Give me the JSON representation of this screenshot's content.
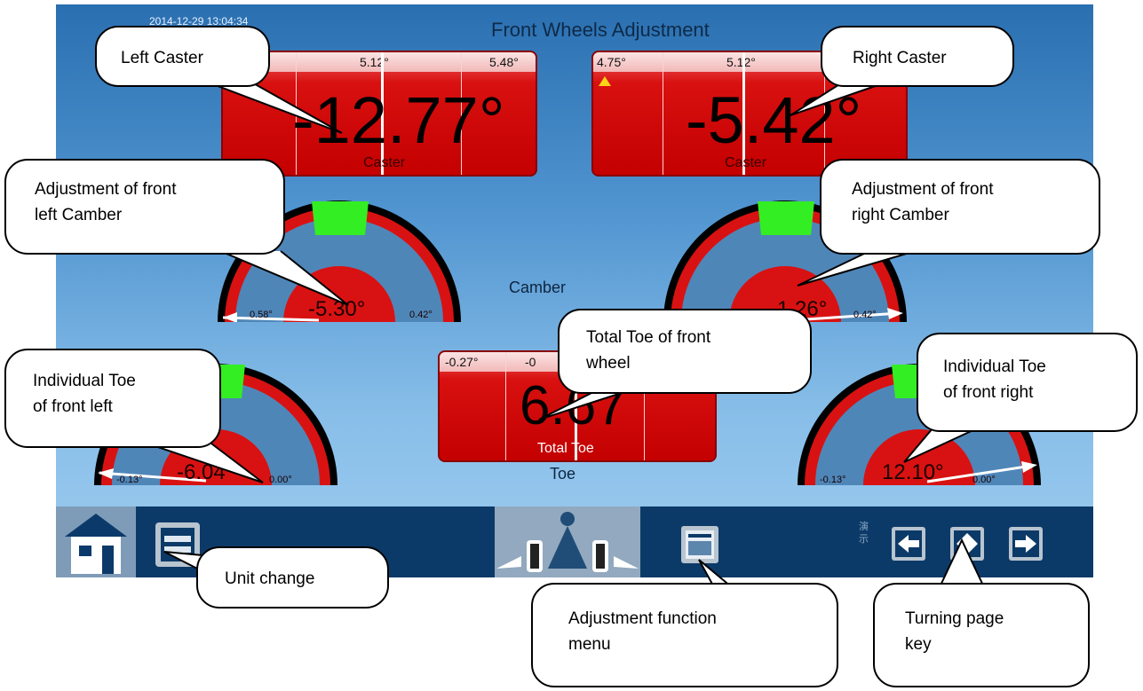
{
  "screen": {
    "timestamp": "2014-12-29 13:04:34",
    "title": "Front Wheels Adjustment"
  },
  "left_caster": {
    "ticks": [
      "5.12°",
      "5.48°"
    ],
    "value": "-12.77°",
    "label": "Caster"
  },
  "right_caster": {
    "ticks": [
      "4.75°",
      "5.12°"
    ],
    "value": "-5.42°",
    "label": "Caster"
  },
  "left_camber": {
    "value": "-5.30°",
    "min": "0.58°",
    "max": "0.42°"
  },
  "right_camber": {
    "value": "-1.26°",
    "max": "0.42°"
  },
  "camber_label": "Camber",
  "total_toe": {
    "ticks": [
      "-0.27°",
      "-0"
    ],
    "value": "6.67",
    "label": "Total Toe"
  },
  "toe_label": "Toe",
  "left_toe": {
    "value": "-6.04°",
    "min": "-0.13°",
    "max": "0.00°"
  },
  "right_toe": {
    "value": "12.10°",
    "min": "-0.13°",
    "max": "0.00°"
  },
  "footer": {
    "demo_label": "演示"
  },
  "callouts": {
    "left_caster": "Left Caster",
    "right_caster": "Right Caster",
    "front_left_camber": "Adjustment  of  front\nleft Camber",
    "front_right_camber": "Adjustment  of  front\nright Camber",
    "total_toe": "Total  Toe  of  front\nwheel",
    "individual_toe_left": "Individual   Toe\nof front left",
    "individual_toe_right": "Individual      Toe\nof front right",
    "unit_change": "Unit change",
    "adjustment_menu": "Adjustment        function\nmenu",
    "turning_page_key": "Turning         page\nkey"
  },
  "colors": {
    "background_top": "#2a6fb0",
    "background_bottom": "#9fcdf0",
    "panel_red": "#c40000",
    "gauge_green": "#33ee22",
    "gauge_blue": "#4f86b8",
    "footer": "#0c3a68"
  },
  "icons": [
    "home-icon",
    "unit-change-icon",
    "car-alignment-icon",
    "adjustment-menu-icon",
    "arrow-left-icon",
    "arrow-swap-icon",
    "arrow-right-icon"
  ]
}
